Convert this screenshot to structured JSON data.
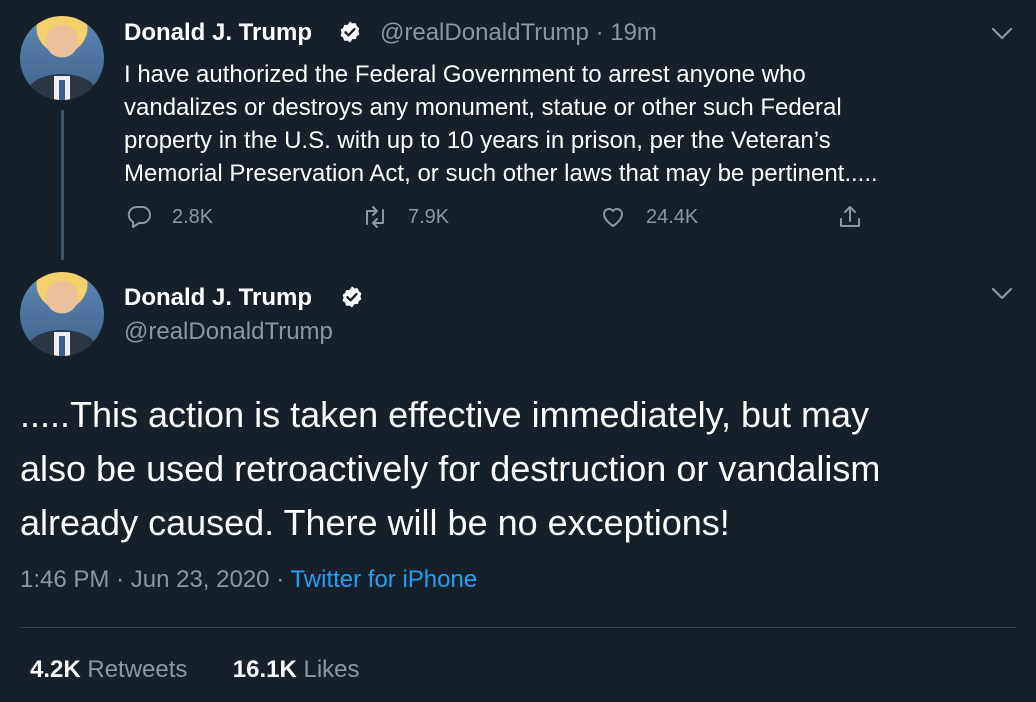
{
  "tweet1": {
    "name": "Donald J. Trump",
    "handle": "@realDonaldTrump",
    "separator": "·",
    "time": "19m",
    "lines": [
      "I have authorized the Federal Government to arrest anyone who",
      "vandalizes or destroys any monument, statue or other such Federal",
      "property in the U.S. with up to 10 years in prison, per the Veteran’s",
      "Memorial Preservation Act, or such other laws that may be pertinent....."
    ],
    "replies": "2.8K",
    "retweets": "7.9K",
    "likes": "24.4K"
  },
  "tweet2": {
    "name": "Donald J. Trump",
    "handle": "@realDonaldTrump",
    "lines": [
      ".....This action is taken effective immediately, but may",
      "also be used retroactively for destruction or vandalism",
      "already caused. There will be no exceptions!"
    ],
    "time": "1:46 PM",
    "dot1": "·",
    "date": "Jun 23, 2020",
    "dot2": "·",
    "source": "Twitter for iPhone",
    "retweet_count": "4.2K",
    "retweet_label": "Retweets",
    "like_count": "16.1K",
    "like_label": "Likes"
  },
  "icons": {
    "verified": "verified-badge-icon",
    "chevron": "chevron-down-icon",
    "reply": "reply-icon",
    "retweet": "retweet-icon",
    "like": "heart-icon",
    "share": "share-icon"
  },
  "colors": {
    "background": "#15202b",
    "secondary_text": "#8899a6",
    "link": "#1da1f2"
  }
}
